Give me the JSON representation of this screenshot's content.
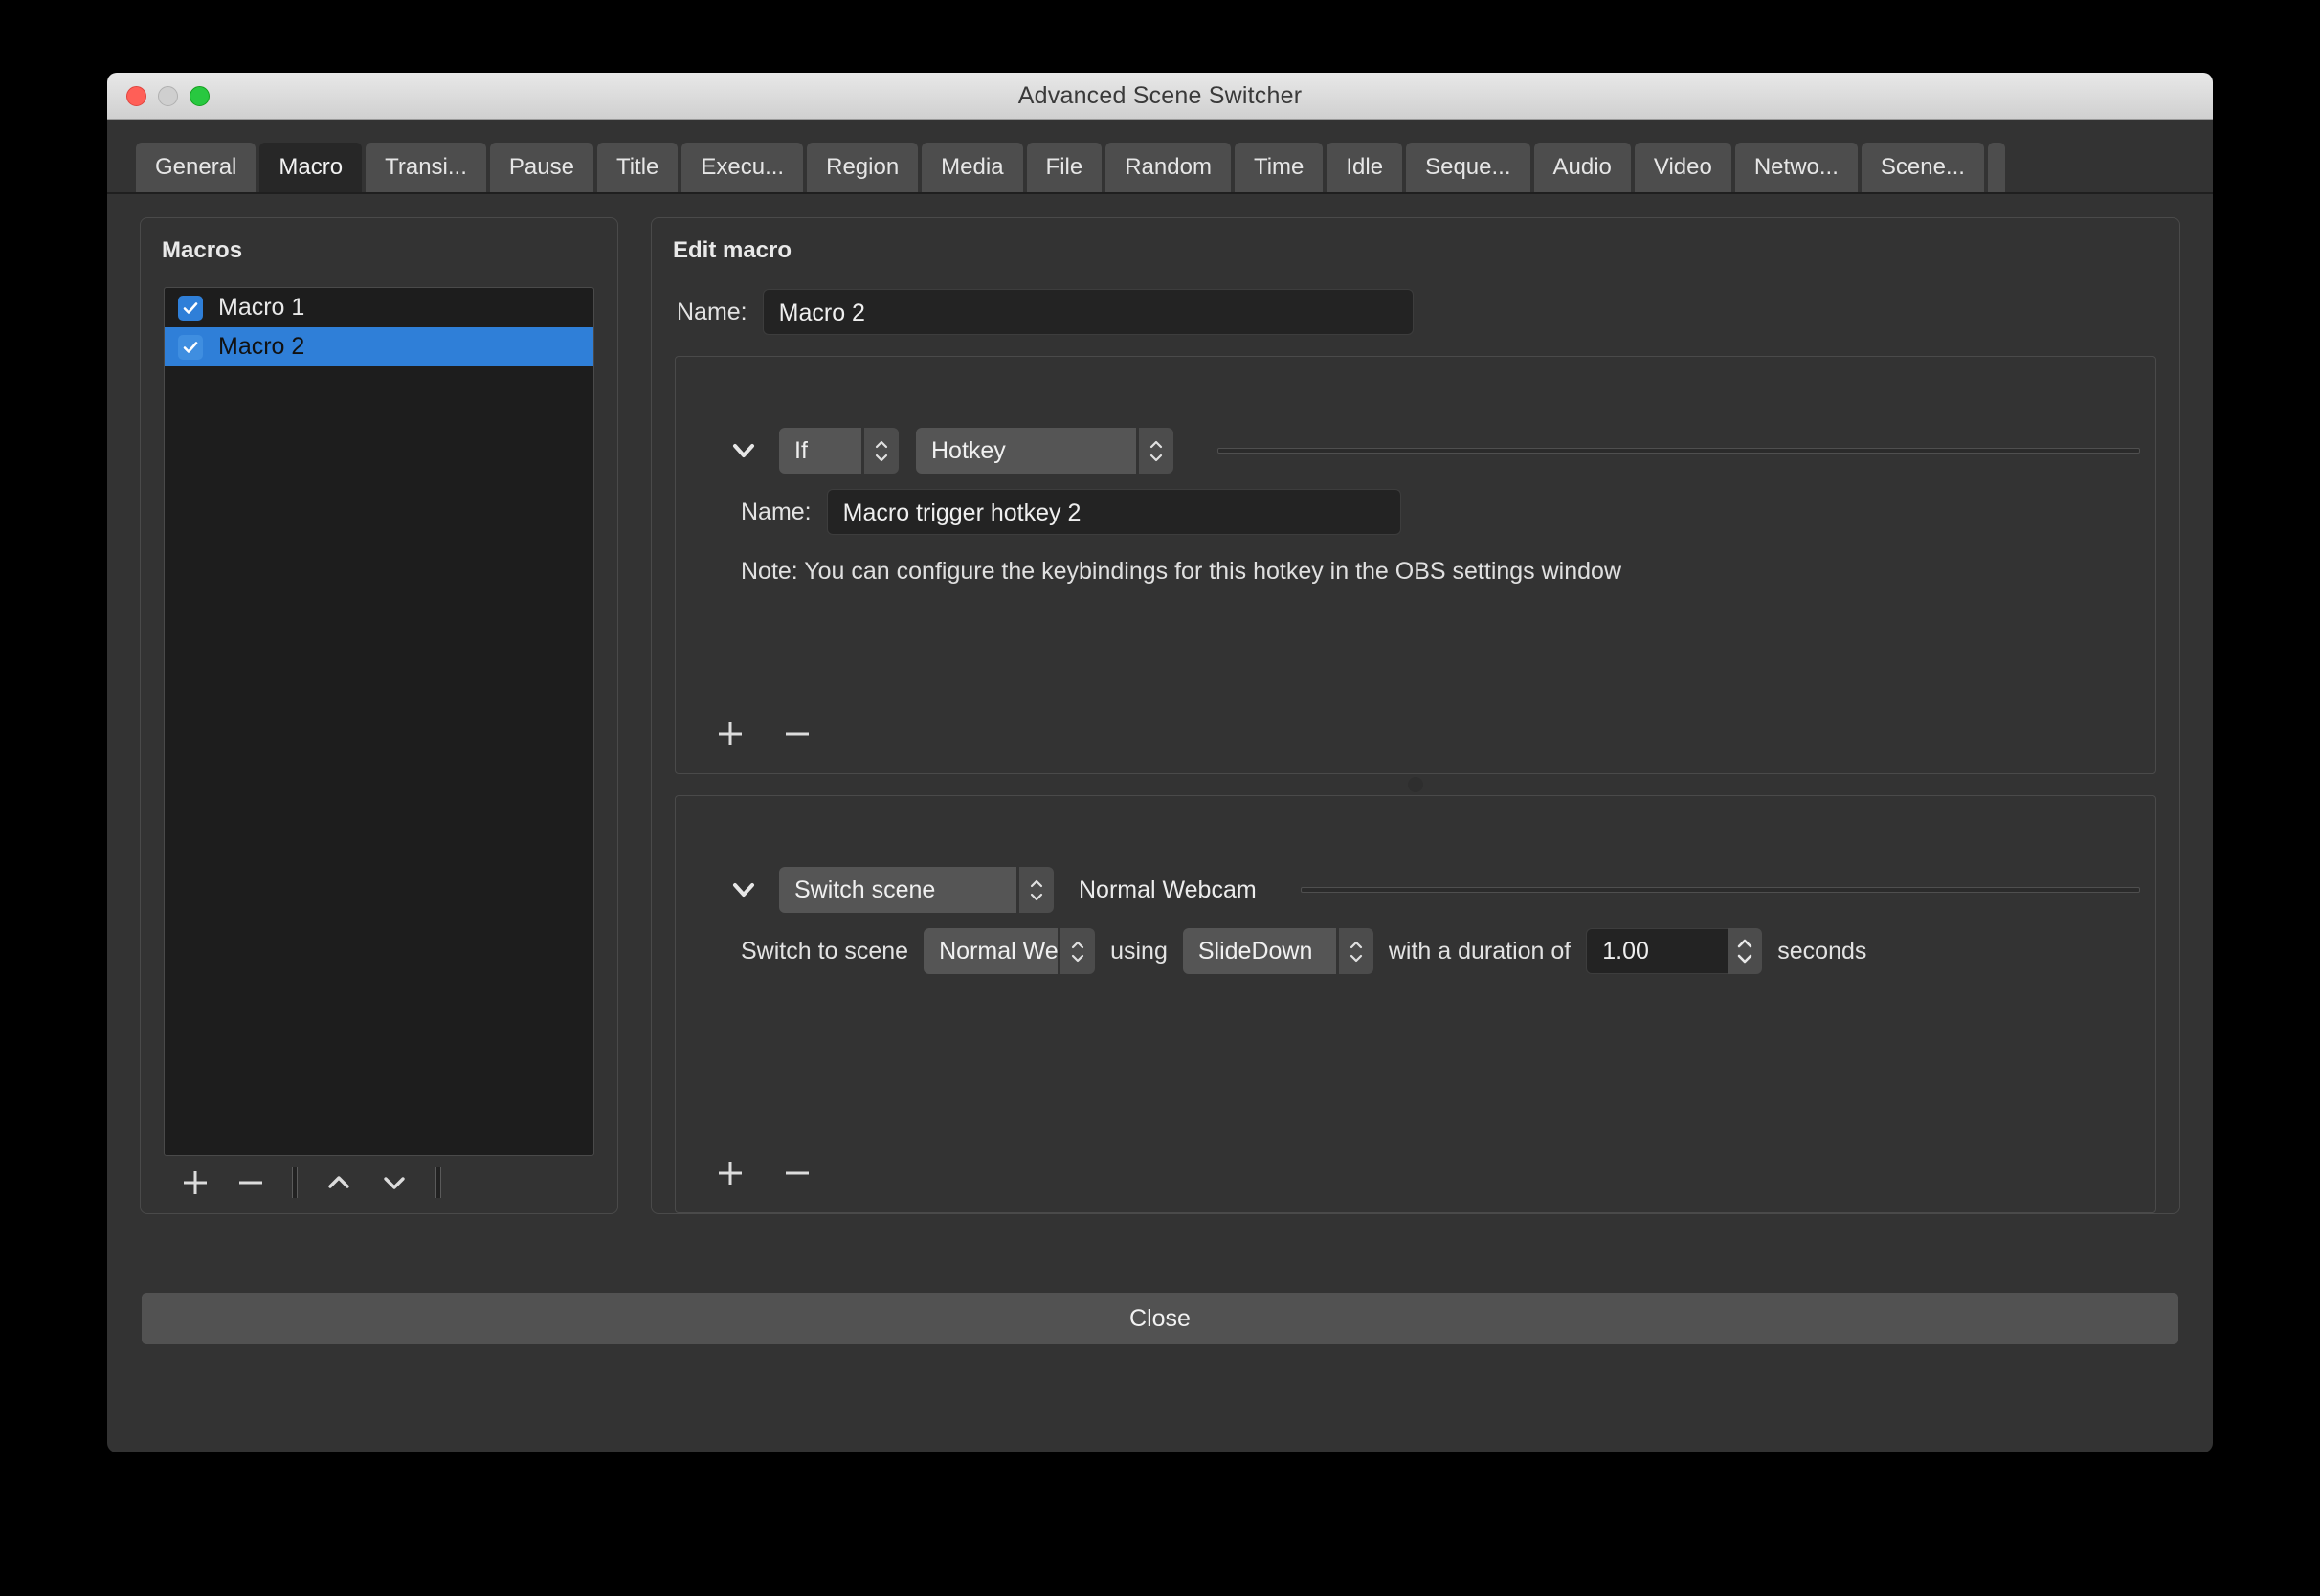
{
  "window": {
    "title": "Advanced Scene Switcher",
    "traffic_lights": [
      "close-red",
      "minimize-yellow",
      "zoom-green"
    ]
  },
  "tabs": [
    {
      "label": "General",
      "active": false
    },
    {
      "label": "Macro",
      "active": true
    },
    {
      "label": "Transi...",
      "active": false
    },
    {
      "label": "Pause",
      "active": false
    },
    {
      "label": "Title",
      "active": false
    },
    {
      "label": "Execu...",
      "active": false
    },
    {
      "label": "Region",
      "active": false
    },
    {
      "label": "Media",
      "active": false
    },
    {
      "label": "File",
      "active": false
    },
    {
      "label": "Random",
      "active": false
    },
    {
      "label": "Time",
      "active": false
    },
    {
      "label": "Idle",
      "active": false
    },
    {
      "label": "Seque...",
      "active": false
    },
    {
      "label": "Audio",
      "active": false
    },
    {
      "label": "Video",
      "active": false
    },
    {
      "label": "Netwo...",
      "active": false
    },
    {
      "label": "Scene...",
      "active": false
    }
  ],
  "macros_panel": {
    "title": "Macros",
    "items": [
      {
        "label": "Macro 1",
        "checked": true,
        "selected": false
      },
      {
        "label": "Macro 2",
        "checked": true,
        "selected": true
      }
    ],
    "toolbar": {
      "add": "+",
      "remove": "−",
      "move_up": "move-up",
      "move_down": "move-down"
    }
  },
  "edit_macro": {
    "title": "Edit macro",
    "name_label": "Name:",
    "name_value": "Macro 2",
    "condition": {
      "logic_operator": "If",
      "condition_type": "Hotkey",
      "name_label": "Name:",
      "hotkey_name": "Macro trigger hotkey 2",
      "note": "Note: You can configure the keybindings for this hotkey in the OBS settings window",
      "toolbar": {
        "add": "+",
        "remove": "−"
      }
    },
    "action": {
      "action_type": "Switch scene",
      "summary": "Normal Webcam",
      "prefix_label": "Switch to scene",
      "scene": "Normal Web",
      "using_label": "using",
      "transition": "SlideDown",
      "duration_label": "with a duration of",
      "duration_value": "1.00",
      "duration_unit": "seconds",
      "toolbar": {
        "add": "+",
        "remove": "−"
      }
    }
  },
  "footer": {
    "close_label": "Close"
  },
  "colors": {
    "accent_blue": "#2f7fd8",
    "window_bg": "#333333",
    "panel_dark": "#1d1d1d",
    "field_bg": "#232323",
    "combo_bg": "#555555",
    "active_tab_bg": "#272727"
  }
}
